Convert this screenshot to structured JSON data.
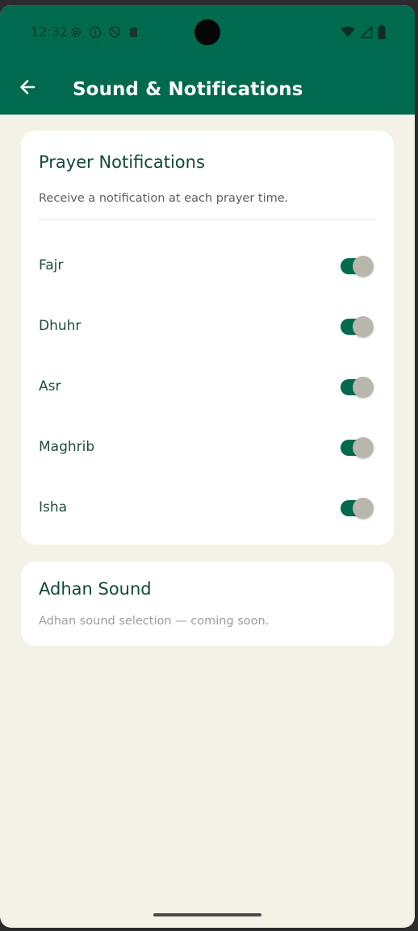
{
  "status_bar": {
    "time": "12:32",
    "left_icons": [
      "settings-icon",
      "info-icon",
      "shield-icon",
      "sim-card-icon"
    ],
    "right_icons": [
      "wifi-icon",
      "cell-signal-icon",
      "battery-icon"
    ]
  },
  "app_bar": {
    "back_icon": "arrow-left-icon",
    "title": "Sound & Notifications"
  },
  "prayer_notifications": {
    "title": "Prayer Notifications",
    "subtitle": "Receive a notification at each prayer time.",
    "items": [
      {
        "label": "Fajr",
        "enabled": true
      },
      {
        "label": "Dhuhr",
        "enabled": true
      },
      {
        "label": "Asr",
        "enabled": true
      },
      {
        "label": "Maghrib",
        "enabled": true
      },
      {
        "label": "Isha",
        "enabled": true
      }
    ]
  },
  "adhan_sound": {
    "title": "Adhan Sound",
    "subtitle": "Adhan sound selection — coming soon."
  },
  "colors": {
    "primary": "#006a4e",
    "background": "#f4f1e6",
    "card": "#ffffff",
    "title_text": "#0e4a3a",
    "switch_thumb": "#b9b6ac"
  }
}
